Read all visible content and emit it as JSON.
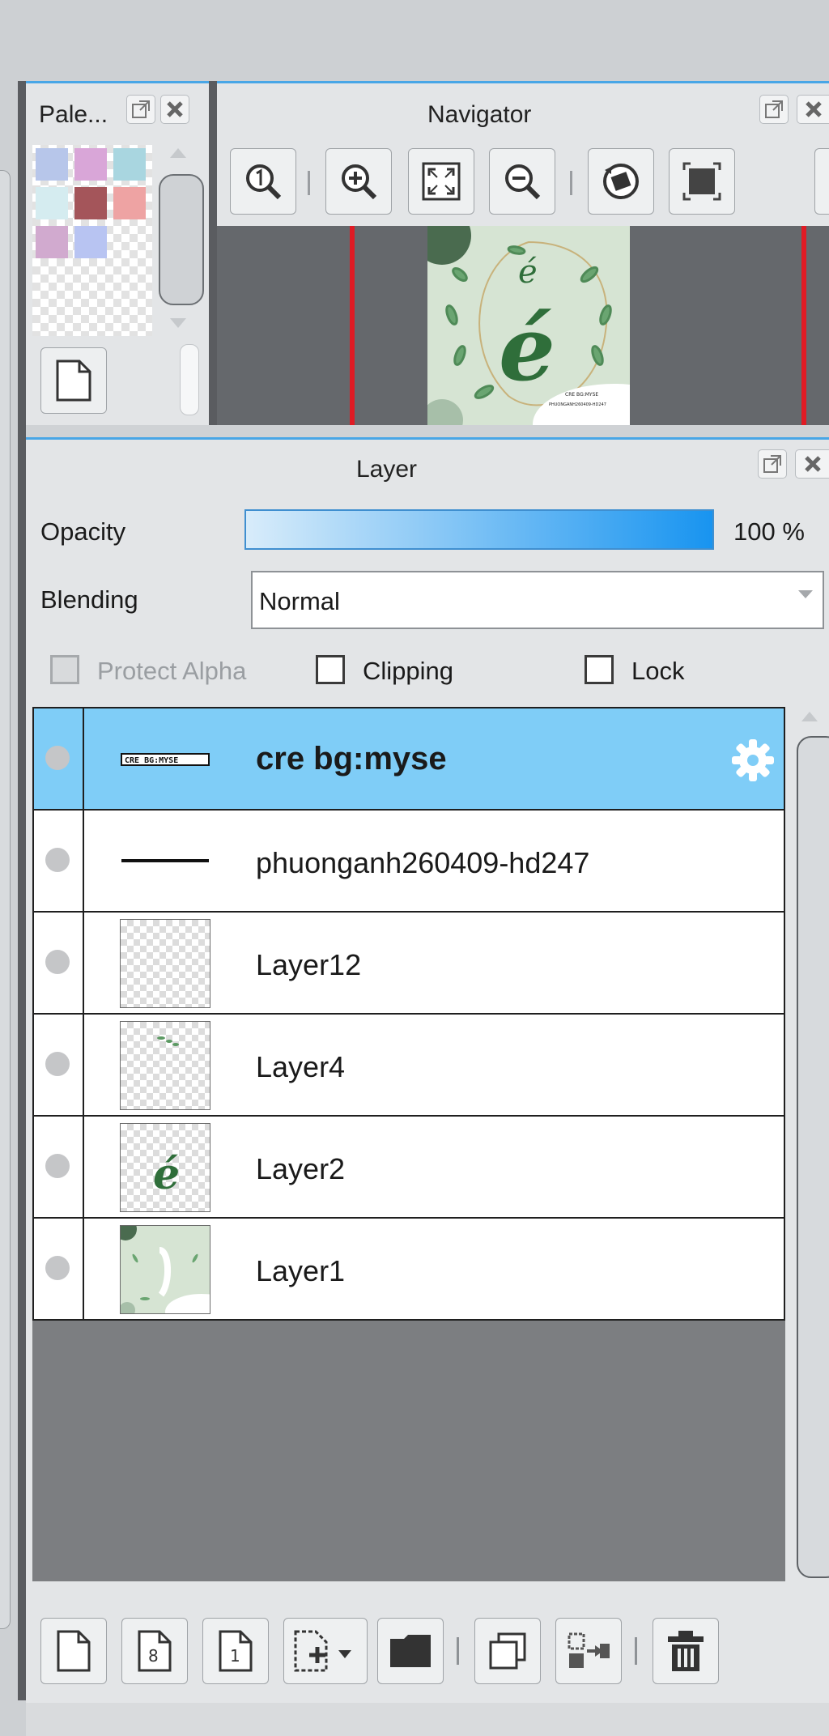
{
  "palette": {
    "title": "Pale...",
    "swatches": [
      "#b7c6ea",
      "#d9a6d8",
      "#a9d6e0",
      "#d5ecf0",
      "#a4555a",
      "#eea3a3",
      "#d1aacf",
      "#b8c4f2"
    ]
  },
  "navigator": {
    "title": "Navigator",
    "thumbnail_text": "é",
    "thumbnail_small_text": "CRE BG:MYSE",
    "thumbnail_small_text2": "PHUONGANH260409-HD247"
  },
  "layer_panel": {
    "title": "Layer",
    "opacity_label": "Opacity",
    "opacity_value": "100 %",
    "opacity_fraction": 1.0,
    "blending_label": "Blending",
    "blending_value": "Normal",
    "protect_alpha_label": "Protect Alpha",
    "clipping_label": "Clipping",
    "lock_label": "Lock",
    "layers": [
      {
        "name": "cre bg:myse",
        "selected": true
      },
      {
        "name": "phuonganh260409-hd247",
        "selected": false
      },
      {
        "name": "Layer12",
        "selected": false
      },
      {
        "name": "Layer4",
        "selected": false
      },
      {
        "name": "Layer2",
        "selected": false
      },
      {
        "name": "Layer1",
        "selected": false
      }
    ],
    "thumb_text_layer0": "CRE BG:MYSE",
    "thumb_text_layer4": "é"
  },
  "colors": {
    "accent": "#48a6e6",
    "selected_row": "#7fcdf7",
    "navigator_red": "#e01b24"
  },
  "icons": {
    "gear": "gear-icon",
    "new_layer": "new-page-icon",
    "folder": "folder-icon",
    "trash": "trash-icon"
  }
}
